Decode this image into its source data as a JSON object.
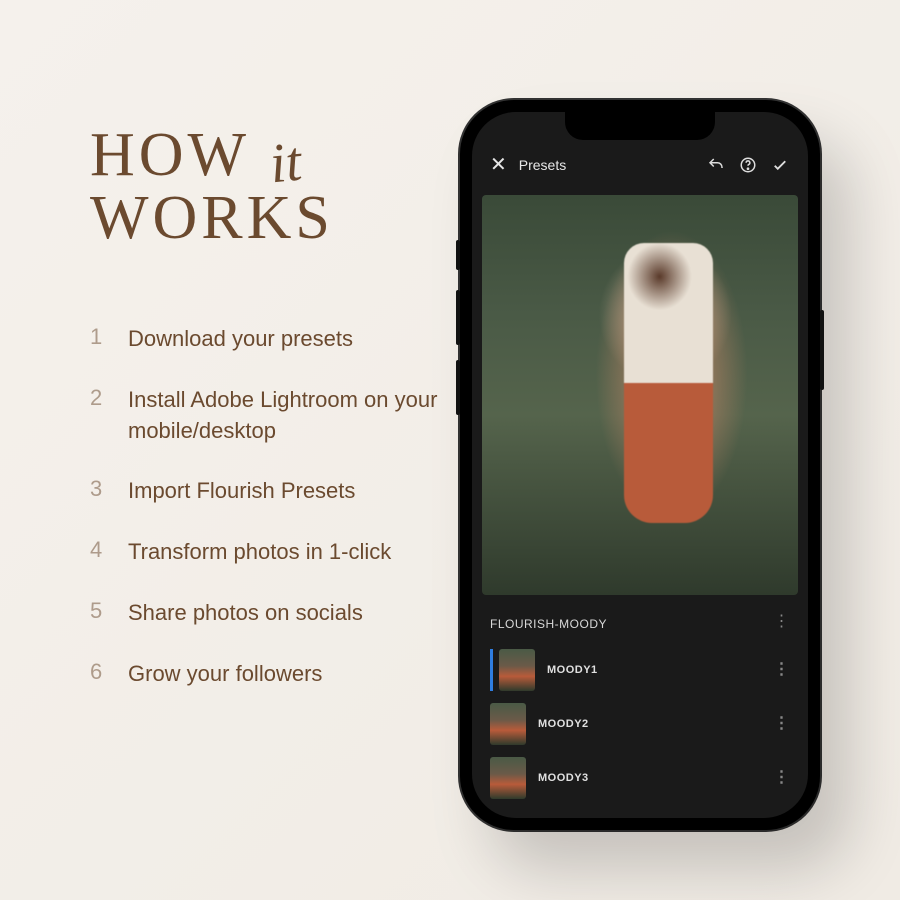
{
  "heading": {
    "word1": "HOW",
    "script": "it",
    "word2": "WORKS"
  },
  "steps": [
    {
      "num": "1",
      "text": "Download your presets"
    },
    {
      "num": "2",
      "text": "Install Adobe Lightroom on your mobile/desktop"
    },
    {
      "num": "3",
      "text": "Import Flourish Presets"
    },
    {
      "num": "4",
      "text": "Transform photos in 1-click"
    },
    {
      "num": "5",
      "text": "Share photos on socials"
    },
    {
      "num": "6",
      "text": "Grow your followers"
    }
  ],
  "phone": {
    "topbar": {
      "title": "Presets"
    },
    "preset_group": "FLOURISH-MOODY",
    "presets": [
      {
        "name": "MOODY1"
      },
      {
        "name": "MOODY2"
      },
      {
        "name": "MOODY3"
      }
    ]
  }
}
